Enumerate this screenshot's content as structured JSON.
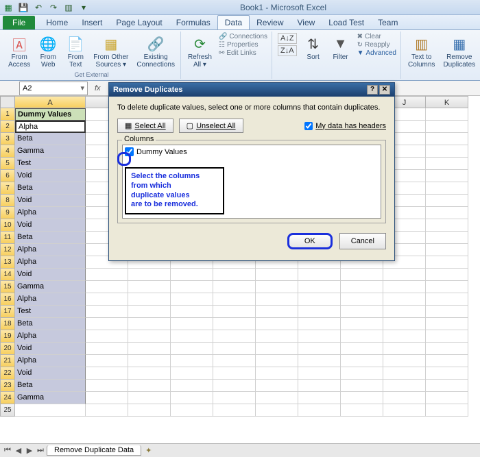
{
  "title": "Book1 - Microsoft Excel",
  "qat": {
    "save": "💾",
    "undo": "↶",
    "redo": "↷",
    "print": "▥"
  },
  "tabs": {
    "file": "File",
    "list": [
      "Home",
      "Insert",
      "Page Layout",
      "Formulas",
      "Data",
      "Review",
      "View",
      "Load Test",
      "Team"
    ],
    "active": "Data"
  },
  "ribbon": {
    "fromAccess": "From\nAccess",
    "fromWeb": "From\nWeb",
    "fromText": "From\nText",
    "fromOther": "From Other\nSources ▾",
    "existing": "Existing\nConnections",
    "groupExternal": "Get External",
    "refresh": "Refresh\nAll ▾",
    "connections": "Connections",
    "properties": "Properties",
    "editLinks": "Edit Links",
    "sortAZ": "A↓Z",
    "sortZA": "Z↓A",
    "sort": "Sort",
    "filter": "Filter",
    "clear": "Clear",
    "reapply": "Reapply",
    "advanced": "Advanced",
    "textToCols": "Text to\nColumns",
    "removeDup": "Remove\nDuplicates"
  },
  "namebox": "A2",
  "columns": [
    "A",
    "J",
    "K"
  ],
  "data": {
    "header": "Dummy Values",
    "rows": [
      "Alpha",
      "Beta",
      "Gamma",
      "Test",
      "Void",
      "Beta",
      "Void",
      "Alpha",
      "Void",
      "Beta",
      "Alpha",
      "Alpha",
      "Void",
      "Gamma",
      "Alpha",
      "Test",
      "Beta",
      "Alpha",
      "Void",
      "Alpha",
      "Void",
      "Beta",
      "Gamma"
    ]
  },
  "emptyRow": 25,
  "sheetTabs": {
    "active": "Remove Duplicate Data"
  },
  "dialog": {
    "title": "Remove Duplicates",
    "msg": "To delete duplicate values, select one or more columns that contain duplicates.",
    "selectAll": "Select All",
    "unselectAll": "Unselect All",
    "headersLabel": "My data has headers",
    "columnsLegend": "Columns",
    "colItem": "Dummy Values",
    "ok": "OK",
    "cancel": "Cancel"
  },
  "annotation": "Select the columns\nfrom which\nduplicate values\nare to be removed."
}
